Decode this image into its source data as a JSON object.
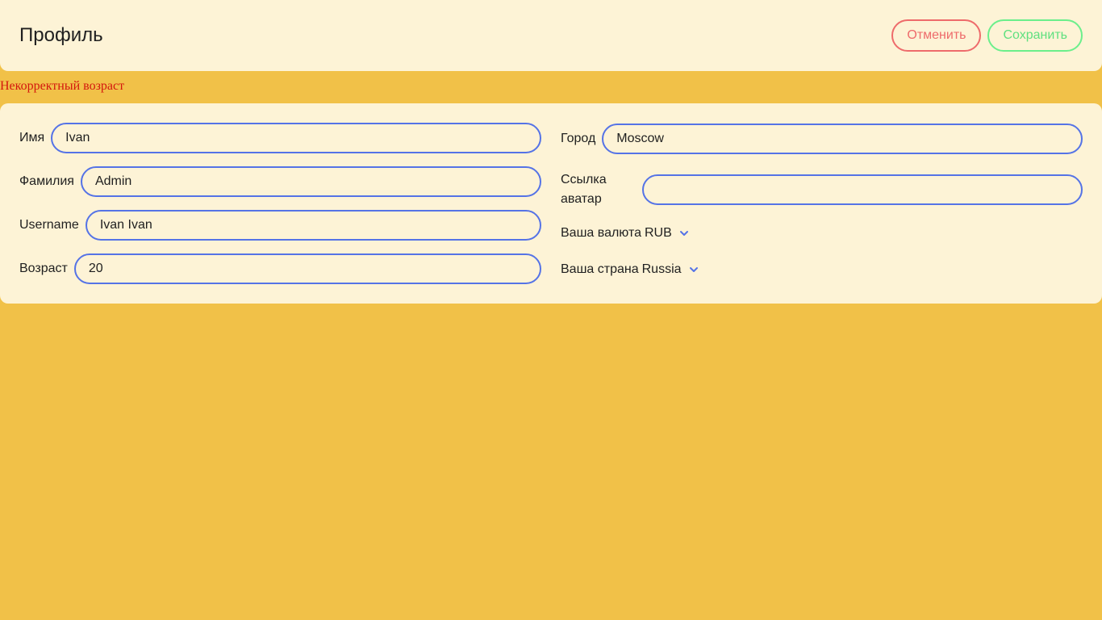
{
  "header": {
    "title": "Профиль",
    "cancel_label": "Отменить",
    "save_label": "Сохранить"
  },
  "error": {
    "message": "Некорректный возраст"
  },
  "form": {
    "first_name": {
      "label": "Имя",
      "value": "Ivan"
    },
    "last_name": {
      "label": "Фамилия",
      "value": "Admin"
    },
    "username": {
      "label": "Username",
      "value": "Ivan Ivan"
    },
    "age": {
      "label": "Возраст",
      "value": "20"
    },
    "city": {
      "label": "Город",
      "value": "Moscow"
    },
    "avatar": {
      "label": "Ссылка аватар",
      "value": ""
    },
    "currency": {
      "label": "Ваша валюта",
      "value": "RUB"
    },
    "country": {
      "label": "Ваша страна",
      "value": "Russia"
    }
  },
  "colors": {
    "background": "#f1c148",
    "card": "#fdf3d6",
    "accent": "#5573e6",
    "cancel": "#ee6b6b",
    "save": "#6bef8b",
    "error": "#d4160d"
  },
  "icons": {
    "dropdown": "chevron-down-icon"
  }
}
